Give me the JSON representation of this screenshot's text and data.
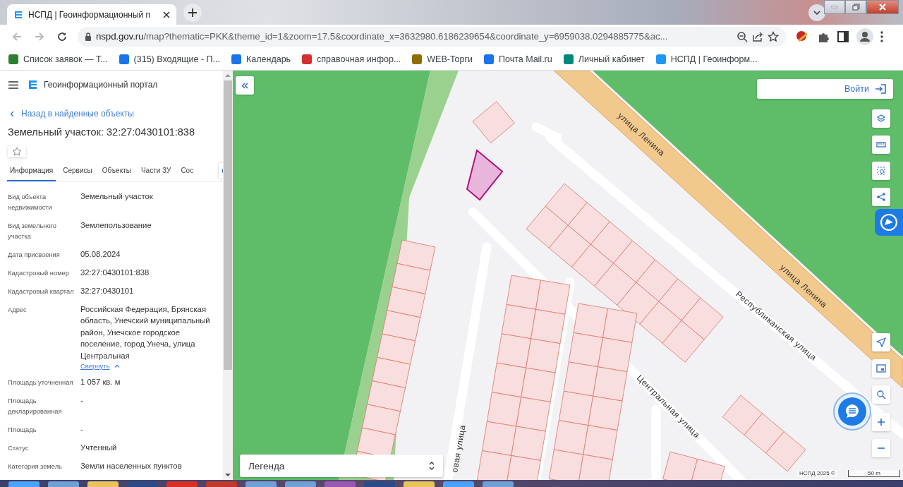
{
  "browser": {
    "tab_title": "НСПД | Геоинформационный п",
    "url_host": "nspd.gov.ru",
    "url_path": "/map?thematic=PKK&theme_id=1&zoom=17.5&coordinate_x=3632980.6186239654&coordinate_y=6959038.0294885775&ac...",
    "bookmarks": [
      {
        "label": "Список заявок — Т...",
        "color": "#2e7d32"
      },
      {
        "label": "(315) Входящие - П...",
        "color": "#1a73e8"
      },
      {
        "label": "Календарь",
        "color": "#1a73e8"
      },
      {
        "label": "справочная инфор...",
        "color": "#d32f2f"
      },
      {
        "label": "WEB-Торги",
        "color": "#8d6e00"
      },
      {
        "label": "Почта Mail.ru",
        "color": "#1a73e8"
      },
      {
        "label": "Личный кабинет",
        "color": "#00897b"
      },
      {
        "label": "НСПД | Геоинформ...",
        "color": "#2196f3"
      }
    ]
  },
  "panel": {
    "portal_title": "Геоинформационный портал",
    "back_link": "Назад в найденные объекты",
    "object_title": "Земельный участок: 32:27:0430101:838",
    "tabs": [
      {
        "label": "Информация",
        "selected": true
      },
      {
        "label": "Сервисы",
        "selected": false
      },
      {
        "label": "Объекты",
        "selected": false
      },
      {
        "label": "Части ЗУ",
        "selected": false
      },
      {
        "label": "Сос",
        "selected": false
      }
    ],
    "fields": [
      {
        "label": "Вид объекта недвижимости",
        "value": "Земельный участок"
      },
      {
        "label": "Вид земельного участка",
        "value": "Землепользование"
      },
      {
        "label": "Дата присвоения",
        "value": "05.08.2024"
      },
      {
        "label": "Кадастровый номер",
        "value": "32:27:0430101:838"
      },
      {
        "label": "Кадастровый квартал",
        "value": "32:27:0430101"
      },
      {
        "label": "Адрес",
        "value": "Российская Федерация, Брянская область, Унечский муниципальный район, Унечское городское поселение, город Унеча, улица Центральная",
        "toggle": "Свернуть"
      },
      {
        "label": "Площадь уточненная",
        "value": "1 057 кв. м"
      },
      {
        "label": "Площадь декларированная",
        "value": "-"
      },
      {
        "label": "Площадь",
        "value": "-"
      },
      {
        "label": "Статус",
        "value": "Учтенный"
      },
      {
        "label": "Категория земель",
        "value": "Земли населенных пунктов"
      }
    ]
  },
  "map": {
    "login": "Войти",
    "legend": "Легенда",
    "attribution": "НСПД 2025 ©",
    "scale": "50 m",
    "streets": [
      "улица Ленина",
      "улица Ленина",
      "Республиканская улица",
      "Центральная улица",
      "овая улица"
    ]
  }
}
